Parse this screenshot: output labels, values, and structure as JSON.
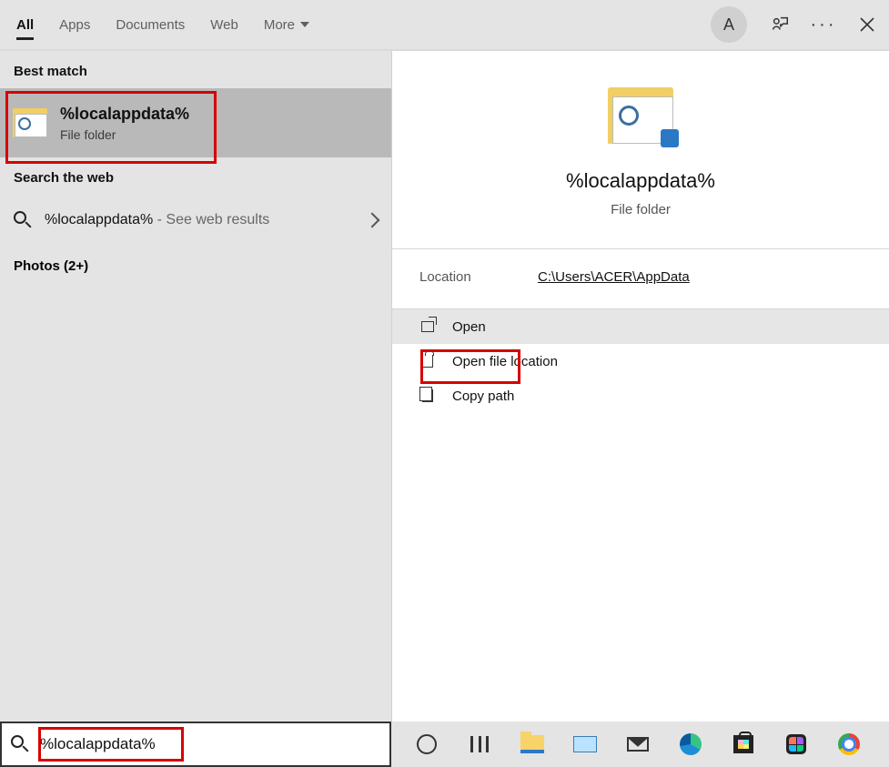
{
  "tabs": {
    "all": "All",
    "apps": "Apps",
    "documents": "Documents",
    "web": "Web",
    "more": "More"
  },
  "avatar_letter": "A",
  "sections": {
    "best_match": "Best match",
    "search_web": "Search the web",
    "photos": "Photos (2+)"
  },
  "best_match": {
    "title": "%localappdata%",
    "subtitle": "File folder"
  },
  "web_result": {
    "term": "%localappdata%",
    "rest": " - See web results"
  },
  "details": {
    "title": "%localappdata%",
    "subtitle": "File folder",
    "location_label": "Location",
    "location_path": "C:\\Users\\ACER\\AppData",
    "actions": {
      "open": "Open",
      "open_location": "Open file location",
      "copy_path": "Copy path"
    }
  },
  "search_value": "%localappdata%"
}
